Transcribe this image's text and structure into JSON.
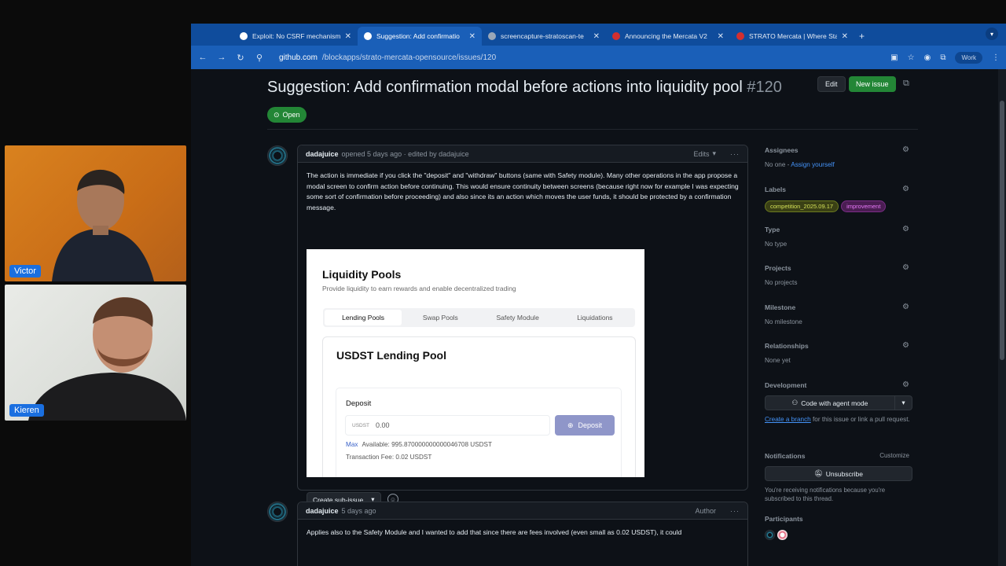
{
  "participants_video": [
    {
      "name": "Victor"
    },
    {
      "name": "Kieren"
    }
  ],
  "browser": {
    "tabs": [
      {
        "title": "Exploit: No CSRF mechanism",
        "active": false
      },
      {
        "title": "Suggestion: Add confirmatio",
        "active": true
      },
      {
        "title": "screencapture-stratoscan-te",
        "active": false
      },
      {
        "title": "Announcing the Mercata V2",
        "active": false
      },
      {
        "title": "STRATO Mercata | Where Sta",
        "active": false
      }
    ],
    "url_host": "github.com",
    "url_path": "/blockapps/strato-mercata-opensource/issues/120",
    "profile_label": "Work"
  },
  "issue": {
    "title": "Suggestion: Add confirmation modal before actions into liquidity pool",
    "number": "#120",
    "edit_label": "Edit",
    "new_issue_label": "New issue",
    "state": "Open"
  },
  "comments": [
    {
      "author": "dadajuice",
      "meta": "opened 5 days ago · edited by dadajuice",
      "edits_label": "Edits",
      "body": "The action is immediate if you click the \"deposit\" and \"withdraw\" buttons (same with Safety module). Many other operations in the app propose a modal screen to confirm action before continuing. This would ensure continuity between screens (because right now for example I was expecting some sort of confirmation before proceeding) and also since its an action which moves the user funds, it should be protected by a confirmation message."
    },
    {
      "author": "dadajuice",
      "meta": "5 days ago",
      "role": "Author",
      "body": "Applies also to the Safety Module and I wanted to add that since there are fees involved (even small as 0.02 USDST), it could"
    }
  ],
  "embed": {
    "title": "Liquidity Pools",
    "subtitle": "Provide liquidity to earn rewards and enable decentralized trading",
    "tabs": [
      "Lending Pools",
      "Swap Pools",
      "Safety Module",
      "Liquidations"
    ],
    "card_title": "USDST Lending Pool",
    "deposit_label": "Deposit",
    "currency": "USDST",
    "input_value": "0.00",
    "deposit_button": "Deposit",
    "max_label": "Max",
    "available": "Available: 995.870000000000046708 USDST",
    "fee": "Transaction Fee: 0.02 USDST"
  },
  "create_subissue_label": "Create sub-issue",
  "sidebar": {
    "assignees": {
      "title": "Assignees",
      "value": "No one -",
      "link": "Assign yourself"
    },
    "labels": {
      "title": "Labels",
      "items": [
        {
          "name": "competition_2025.09.17",
          "color": "#d4e157"
        },
        {
          "name": "improvement",
          "color": "#e879f9"
        }
      ]
    },
    "type": {
      "title": "Type",
      "value": "No type"
    },
    "projects": {
      "title": "Projects",
      "value": "No projects"
    },
    "milestone": {
      "title": "Milestone",
      "value": "No milestone"
    },
    "relationships": {
      "title": "Relationships",
      "value": "None yet"
    },
    "development": {
      "title": "Development",
      "button": "Code with agent mode",
      "link": "Create a branch",
      "note": "for this issue or link a pull request."
    },
    "notifications": {
      "title": "Notifications",
      "customize": "Customize",
      "button": "Unsubscribe",
      "note": "You're receiving notifications because you're subscribed to this thread."
    },
    "participants": {
      "title": "Participants"
    }
  },
  "colors": {
    "accent_green": "#238636",
    "link_blue": "#4493f8",
    "tab_bar": "#0f4c9c"
  }
}
